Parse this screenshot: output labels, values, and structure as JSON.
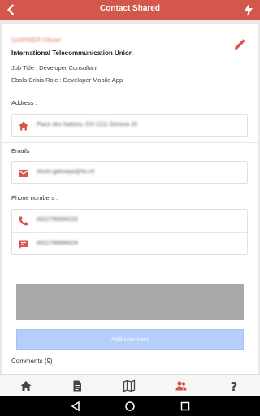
{
  "header": {
    "title": "Contact Shared",
    "color": "#d3574b"
  },
  "contact": {
    "name": "GARNIER Olivier",
    "organization": "International Telecommunication Union",
    "job_title": "Job Title : Developer Consultant",
    "crisis_role": "Ebola Crisis Role : Developer Mobile App"
  },
  "address": {
    "label": "Address :",
    "value": "Place des Nations, CH-1211 Geneva 20"
  },
  "emails": {
    "label": "Emails :",
    "value": "olivier.gakwaya@itu.int"
  },
  "phones": {
    "label": "Phone numbers :",
    "items": [
      "0022795690029",
      "0022795690029"
    ]
  },
  "comment": {
    "button_label": "Add comment",
    "count_label": "Comments (9)"
  },
  "tabs": [
    {
      "icon": "home-icon",
      "active": false
    },
    {
      "icon": "document-icon",
      "active": false
    },
    {
      "icon": "map-icon",
      "active": false
    },
    {
      "icon": "contacts-icon",
      "active": true
    },
    {
      "icon": "help-icon",
      "active": false
    }
  ],
  "accent_color": "#d3574b",
  "button_color": "#b6cefc"
}
